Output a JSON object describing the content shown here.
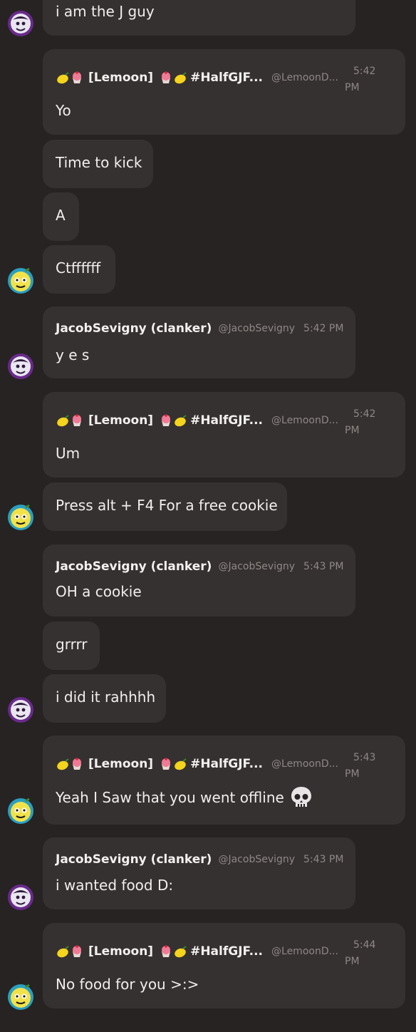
{
  "messages": [
    {
      "text": "i am the J guy"
    },
    {
      "author": "[Lemoon]",
      "tag": "#HalfGJF...",
      "handle": "@LemoonD...",
      "time": "5:42",
      "ampm": "PM",
      "text": "Yo"
    },
    {
      "text": "Time to kick"
    },
    {
      "text": "A"
    },
    {
      "text": "Ctffffff"
    },
    {
      "author": "JacobSevigny (clanker)",
      "handle": "@JacobSevigny",
      "time": "5:42 PM",
      "text": "y e s"
    },
    {
      "author": "[Lemoon]",
      "tag": "#HalfGJF...",
      "handle": "@LemoonD...",
      "time": "5:42",
      "ampm": "PM",
      "text": "Um"
    },
    {
      "text": "Press alt + F4 For a free cookie"
    },
    {
      "author": "JacobSevigny (clanker)",
      "handle": "@JacobSevigny",
      "time": "5:43 PM",
      "text": "OH a cookie"
    },
    {
      "text": "grrrr"
    },
    {
      "text": "i did it rahhhh"
    },
    {
      "author": "[Lemoon]",
      "tag": "#HalfGJF...",
      "handle": "@LemoonD...",
      "time": "5:43",
      "ampm": "PM",
      "text": "Yeah I Saw that you went offline"
    },
    {
      "author": "JacobSevigny (clanker)",
      "handle": "@JacobSevigny",
      "time": "5:43 PM",
      "text": "i wanted food D:"
    },
    {
      "author": "[Lemoon]",
      "tag": "#HalfGJF...",
      "handle": "@LemoonD...",
      "time": "5:44",
      "ampm": "PM",
      "text": "No food for you >:>"
    }
  ]
}
